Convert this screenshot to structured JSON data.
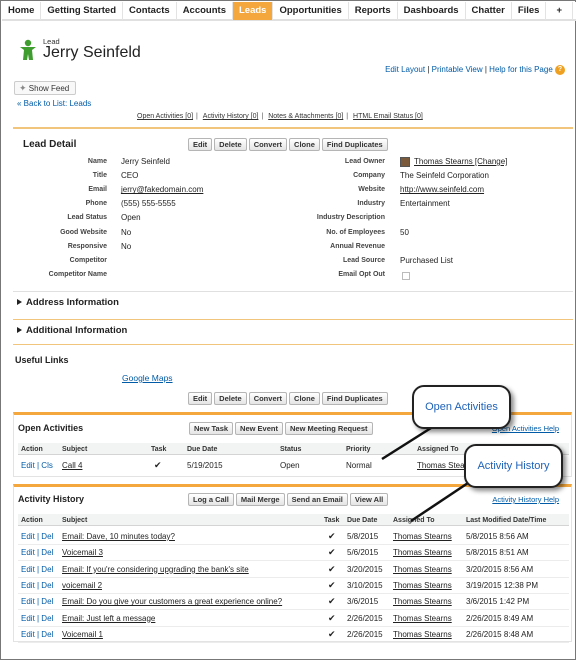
{
  "nav": {
    "tabs": [
      "Home",
      "Getting Started",
      "Contacts",
      "Accounts",
      "Leads",
      "Opportunities",
      "Reports",
      "Dashboards",
      "Chatter",
      "Files",
      "+"
    ],
    "active": "Leads"
  },
  "header": {
    "record_type": "Lead",
    "name": "Jerry Seinfeld",
    "links": [
      "Edit Layout",
      "Printable View",
      "Help for this Page"
    ]
  },
  "show_feed": "Show Feed",
  "back_link": "« Back to List: Leads",
  "related": [
    "Open Activities [0]",
    "Activity History [0]",
    "Notes & Attachments [0]",
    "HTML Email Status [0]"
  ],
  "detail": {
    "title": "Lead Detail",
    "buttons": [
      "Edit",
      "Delete",
      "Convert",
      "Clone",
      "Find Duplicates"
    ],
    "left": [
      [
        "Name",
        "Jerry Seinfeld"
      ],
      [
        "Title",
        "CEO"
      ],
      [
        "Email",
        "jerry@fakedomain.com"
      ],
      [
        "Phone",
        "(555) 555-5555"
      ],
      [
        "Lead Status",
        "Open"
      ],
      [
        "Good Website",
        "No"
      ],
      [
        "Responsive",
        "No"
      ],
      [
        "Competitor",
        ""
      ],
      [
        "Competitor Name",
        ""
      ]
    ],
    "right": [
      [
        "Lead Owner",
        "Thomas Stearns [Change]"
      ],
      [
        "Company",
        "The Seinfeld Corporation"
      ],
      [
        "Website",
        "http://www.seinfeld.com"
      ],
      [
        "Industry",
        "Entertainment"
      ],
      [
        "Industry Description",
        ""
      ],
      [
        "No. of Employees",
        "50"
      ],
      [
        "Annual Revenue",
        ""
      ],
      [
        "Lead Source",
        "Purchased List"
      ],
      [
        "Email Opt Out",
        ""
      ]
    ]
  },
  "sections": [
    "Address Information",
    "Additional Information"
  ],
  "useful": {
    "title": "Useful Links",
    "link": "Google Maps"
  },
  "open_activities": {
    "title": "Open Activities",
    "buttons": [
      "New Task",
      "New Event",
      "New Meeting Request"
    ],
    "help": "Open Activities Help",
    "columns": [
      "Action",
      "Subject",
      "Task",
      "Due Date",
      "Status",
      "Priority",
      "Assigned To"
    ],
    "rows": [
      {
        "action": "Edit | Cls",
        "subject": "Call 4",
        "task": true,
        "due": "5/19/2015",
        "status": "Open",
        "priority": "Normal",
        "assigned": "Thomas Stearns"
      }
    ]
  },
  "activity_history": {
    "title": "Activity History",
    "buttons": [
      "Log a Call",
      "Mail Merge",
      "Send an Email",
      "View All"
    ],
    "help": "Activity History Help",
    "columns": [
      "Action",
      "Subject",
      "Task",
      "Due Date",
      "Assigned To",
      "Last Modified Date/Time"
    ],
    "rows": [
      {
        "action": "Edit | Del",
        "subject": "Email: Dave, 10 minutes today?",
        "due": "5/8/2015",
        "assigned": "Thomas Stearns",
        "modified": "5/8/2015 8:56 AM"
      },
      {
        "action": "Edit | Del",
        "subject": "Voicemail 3",
        "due": "5/6/2015",
        "assigned": "Thomas Stearns",
        "modified": "5/8/2015 8:51 AM"
      },
      {
        "action": "Edit | Del",
        "subject": "Email: If you're considering upgrading the bank's site",
        "due": "3/20/2015",
        "assigned": "Thomas Stearns",
        "modified": "3/20/2015 8:56 AM"
      },
      {
        "action": "Edit | Del",
        "subject": "voicemail 2",
        "due": "3/10/2015",
        "assigned": "Thomas Stearns",
        "modified": "3/19/2015 12:38 PM"
      },
      {
        "action": "Edit | Del",
        "subject": "Email: Do you give your customers a great experience online?",
        "due": "3/6/2015",
        "assigned": "Thomas Stearns",
        "modified": "3/6/2015 1:42 PM"
      },
      {
        "action": "Edit | Del",
        "subject": "Email: Just left a message",
        "due": "2/26/2015",
        "assigned": "Thomas Stearns",
        "modified": "2/26/2015 8:49 AM"
      },
      {
        "action": "Edit | Del",
        "subject": "Voicemail 1",
        "due": "2/26/2015",
        "assigned": "Thomas Stearns",
        "modified": "2/26/2015 8:48 AM"
      }
    ]
  },
  "callouts": [
    "Open Activities",
    "Activity History"
  ],
  "icons": [
    "lead-person-icon",
    "feed-icon",
    "help-icon",
    "owner-avatar-icon",
    "checkbox-icon"
  ],
  "colors": {
    "active_tab": "#f4a73c",
    "link": "#015ba7",
    "callout_text": "#1f62b8"
  }
}
